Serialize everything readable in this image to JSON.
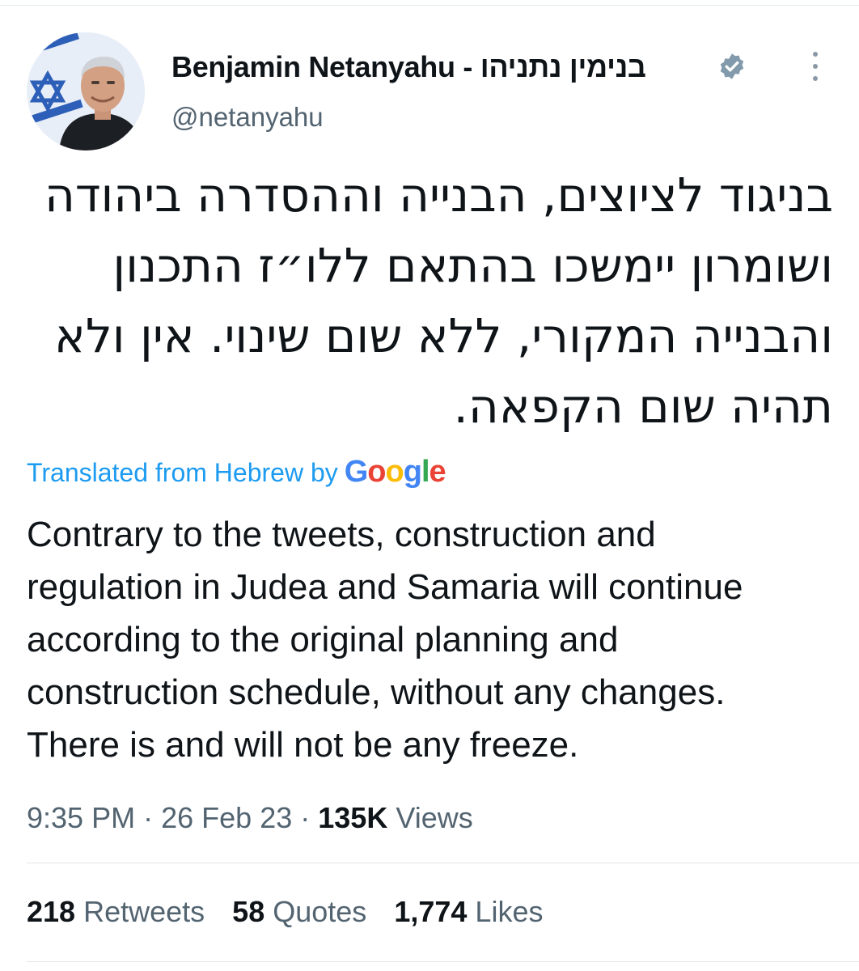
{
  "author": {
    "display_name": "Benjamin Netanyahu - בנימין נתניהו",
    "handle": "@netanyahu",
    "verified": true,
    "avatar_icon": "profile-photo-avatar",
    "verified_icon": "verified-badge-icon",
    "more_icon": "more-options-vertical-dots-icon"
  },
  "tweet": {
    "hebrew_lines": [
      "בניגוד לציוצים, הבנייה וההסדרה ביהודה",
      "ושומרון יימשכו בהתאם ללו״ז התכנון",
      "והבנייה המקורי, ללא שום שינוי. אין ולא",
      "תהיה שום הקפאה."
    ],
    "translation_label": "Translated from Hebrew by",
    "translation_provider": "Google",
    "english_lines": [
      "Contrary to the tweets, construction and",
      "regulation in Judea and Samaria will continue",
      "according to the original planning and",
      "construction schedule, without any changes.",
      "There is and will not be any freeze."
    ]
  },
  "meta": {
    "time": "9:35 PM",
    "separator": "·",
    "date": "26 Feb 23",
    "views_count": "135K",
    "views_label": "Views"
  },
  "stats": {
    "retweets_count": "218",
    "retweets_label": "Retweets",
    "quotes_count": "58",
    "quotes_label": "Quotes",
    "likes_count": "1,774",
    "likes_label": "Likes"
  },
  "colors": {
    "link_blue": "#1d9bf0",
    "secondary_text": "#536471",
    "primary_text": "#0f1419",
    "verified_badge": "#829aab",
    "google_blue": "#4285f4",
    "google_red": "#ea4335",
    "google_yellow": "#fbbc05",
    "google_green": "#34a853"
  }
}
